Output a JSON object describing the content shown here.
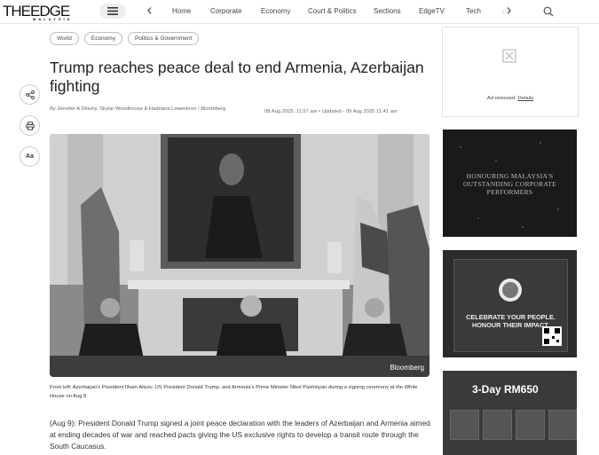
{
  "header": {
    "logo_main": "THEEDGE",
    "logo_sub": "MALAYSIA",
    "nav": [
      "Home",
      "Corporate",
      "Economy",
      "Court & Politics",
      "Sections",
      "EdgeTV",
      "Tech"
    ],
    "nav_prev_icon": "chevron-left-icon",
    "nav_next_icon": "chevron-right-icon",
    "menu_icon": "hamburger-icon",
    "search_icon": "search-icon"
  },
  "article": {
    "tags": [
      "World",
      "Economy",
      "Politics & Government"
    ],
    "title": "Trump reaches peace deal to end Armenia, Azerbaijan fighting",
    "byline": "By  Jennifer A Dlouhy, Skylar Woodhouse & Hadriana Lowenkron / Bloomberg",
    "dates": "08 Aug 2025, 11:57 am  •  Updated - 09 Aug 2025 11:41 am",
    "image_credit": "Bloomberg",
    "caption": "From left: Azerbaijan's President Ilham Aliyev, US President Donald Trump, and Armenia's Prime Minister Nikol Pashinyan during a signing ceremony at the White House on Aug 8.",
    "lead": "(Aug 9): President Donald Trump signed a joint peace declaration with the leaders of Azerbaijan and Armenia aimed at ending decades of war and reached pacts giving the US exclusive rights to develop a transit route through the South Caucasus."
  },
  "share_tools": {
    "share_icon": "share-icon",
    "print_icon": "print-icon",
    "font_size_label": "Aa"
  },
  "ads": {
    "removed_text": "Ad removed.",
    "removed_link": "Details",
    "ad2_text": "HONOURING MALAYSIA'S OUTSTANDING CORPORATE PERFORMERS",
    "ad3_headline": "CELEBRATE YOUR PEOPLE. HONOUR THEIR IMPACT.",
    "ad4_headline": "3-Day RM650"
  },
  "colors": {
    "background": "#ffffff",
    "text": "#222222",
    "muted": "#666666"
  }
}
